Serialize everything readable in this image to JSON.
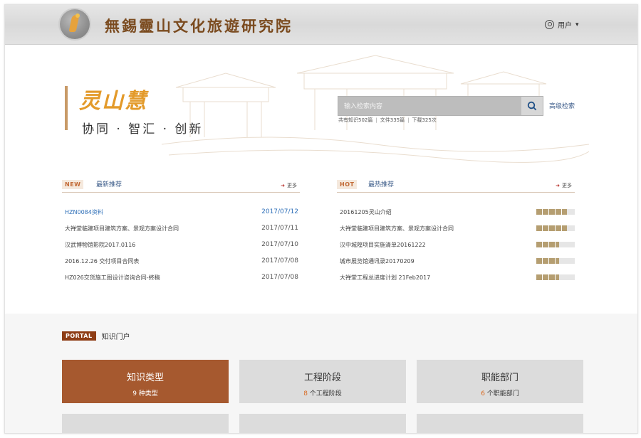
{
  "header": {
    "site_title": "無錫靈山文化旅遊研究院",
    "user_label": "用户"
  },
  "hero": {
    "slogan_title": "灵山慧",
    "slogan_sub": "协同 · 智汇 · 创新",
    "search_placeholder": "输入检索内容",
    "advanced_search": "高级检索",
    "stats": [
      "共有知识502篇",
      "文件335篇",
      "下载325次"
    ]
  },
  "new_section": {
    "badge": "NEW",
    "title": "最新推荐",
    "more": "更多",
    "items": [
      {
        "title": "HZN0084资料",
        "date": "2017/07/12"
      },
      {
        "title": "大禅堂临建项目建筑方案、景观方案设计合同",
        "date": "2017/07/11"
      },
      {
        "title": "汉武博物馆影院2017.0116",
        "date": "2017/07/10"
      },
      {
        "title": "2016.12.26 交付项目合同表",
        "date": "2017/07/08"
      },
      {
        "title": "HZ026交货施工图设计咨询合同-終稿",
        "date": "2017/07/08"
      }
    ]
  },
  "hot_section": {
    "badge": "HOT",
    "title": "最热推荐",
    "more": "更多",
    "items": [
      {
        "title": "20161205灵山介绍",
        "heat": 0.8
      },
      {
        "title": "大禅堂临建项目建筑方案、景观方案设计合同",
        "heat": 0.8
      },
      {
        "title": "汉中城隍项目实施清单20161222",
        "heat": 0.6
      },
      {
        "title": "城市展览馆通讯录20170209",
        "heat": 0.6
      },
      {
        "title": "大禅堂工程总进度计划 21Feb2017",
        "heat": 0.6
      }
    ]
  },
  "portal": {
    "badge": "PORTAL",
    "title": "知识门户",
    "tiles": [
      {
        "name": "知识类型",
        "count": "9",
        "unit": "种类型"
      },
      {
        "name": "工程阶段",
        "count": "8",
        "unit": "个工程阶段"
      },
      {
        "name": "职能部门",
        "count": "6",
        "unit": "个职能部门"
      }
    ]
  },
  "colors": {
    "accent": "#a6592f",
    "title_brown": "#7a4a1e",
    "link_blue": "#2e6fb8",
    "heat_bar": "#b59e71"
  }
}
